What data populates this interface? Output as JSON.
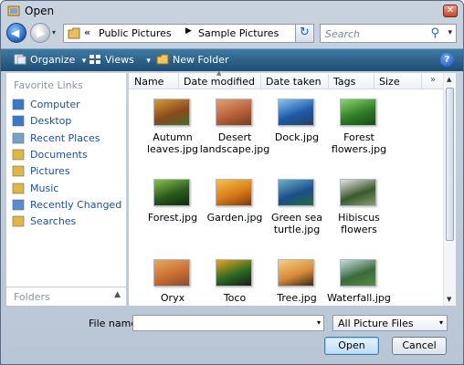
{
  "window": {
    "title": "Open",
    "close_glyph": "✕"
  },
  "nav": {
    "back_glyph": "◀",
    "forward_glyph": "▶",
    "history_glyph": "▾"
  },
  "address": {
    "overflow": "«",
    "crumbs": [
      "Public Pictures",
      "Sample Pictures"
    ],
    "separator": "▶",
    "dropdown_glyph": "▾",
    "refresh_glyph": "↻"
  },
  "search": {
    "placeholder": "Search",
    "icon_glyph": "⚲",
    "dropdown_glyph": "▾"
  },
  "toolbar": {
    "organize": "Organize",
    "views": "Views",
    "new_folder": "New Folder",
    "dropdown_glyph": "▾",
    "help": "?"
  },
  "favorites": {
    "title": "Favorite Links",
    "items": [
      {
        "label": "Computer",
        "icon": "computer-icon",
        "color": "#3a78c8"
      },
      {
        "label": "Desktop",
        "icon": "desktop-icon",
        "color": "#3a78c8"
      },
      {
        "label": "Recent Places",
        "icon": "recent-places-icon",
        "color": "#7aa0c8"
      },
      {
        "label": "Documents",
        "icon": "documents-icon",
        "color": "#e3b640"
      },
      {
        "label": "Pictures",
        "icon": "pictures-icon",
        "color": "#e3b640"
      },
      {
        "label": "Music",
        "icon": "music-icon",
        "color": "#e3b640"
      },
      {
        "label": "Recently Changed",
        "icon": "recently-changed-icon",
        "color": "#5a8ad0"
      },
      {
        "label": "Searches",
        "icon": "searches-icon",
        "color": "#e3b640"
      }
    ],
    "folders_label": "Folders",
    "folders_caret": "▲"
  },
  "columns": {
    "headers": [
      "Name",
      "Date modified",
      "Date taken",
      "Tags",
      "Size"
    ],
    "more_glyph": "»",
    "sort_glyph": "▲"
  },
  "files": [
    {
      "label": "Autumn\nleaves.jpg",
      "colors": [
        "#8b4a1c",
        "#d89a3a",
        "#4a6a2a"
      ]
    },
    {
      "label": "Desert\nlandscape.jpg",
      "colors": [
        "#b8613a",
        "#e0a074",
        "#7a3a20"
      ]
    },
    {
      "label": "Dock.jpg",
      "colors": [
        "#1e5aa8",
        "#8ac4ef",
        "#2a3e5a"
      ]
    },
    {
      "label": "Forest\nflowers.jpg",
      "colors": [
        "#2f7d28",
        "#8bd46a",
        "#1a4a16"
      ]
    },
    {
      "label": "Forest.jpg",
      "colors": [
        "#2a5a1e",
        "#8cbf4c",
        "#0f2a0c"
      ]
    },
    {
      "label": "Garden.jpg",
      "colors": [
        "#d87a1a",
        "#f4c244",
        "#7a3a0a"
      ]
    },
    {
      "label": "Green sea\nturtle.jpg",
      "colors": [
        "#1b4e8a",
        "#6fb0c8",
        "#2a6a3a"
      ]
    },
    {
      "label": "Hibiscus\nflowers",
      "colors": [
        "#3a5a2a",
        "#e8e0e6",
        "#8a9a7a"
      ]
    },
    {
      "label": "Oryx\nAntelope.jpg",
      "colors": [
        "#c96e32",
        "#e8a860",
        "#8a4a2a"
      ]
    },
    {
      "label": "Toco\nToucan.jpg",
      "colors": [
        "#2a6a22",
        "#f0a020",
        "#1a1a1a"
      ]
    },
    {
      "label": "Tree.jpg",
      "colors": [
        "#d88a3a",
        "#f4d080",
        "#3a2a1a"
      ]
    },
    {
      "label": "Waterfall.jpg",
      "colors": [
        "#3a6a3a",
        "#c8dce0",
        "#5a8a4a"
      ]
    }
  ],
  "footer": {
    "file_name_label": "File name:",
    "file_name_value": "",
    "file_type": "All Picture Files",
    "open": "Open",
    "cancel": "Cancel",
    "dropdown_glyph": "▾"
  }
}
